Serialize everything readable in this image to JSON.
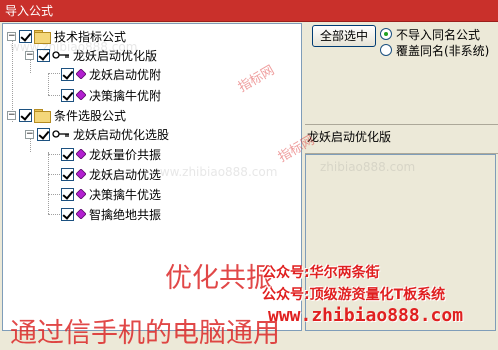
{
  "window": {
    "title": "导入公式"
  },
  "tree": {
    "groups": [
      {
        "label": "技术指标公式",
        "folders": [
          {
            "label": "龙妖启动优化版",
            "items": [
              "龙妖启动优附",
              "决策擒牛优附"
            ]
          }
        ]
      },
      {
        "label": "条件选股公式",
        "folders": [
          {
            "label": "龙妖启动优化选股",
            "items": [
              "龙妖量价共振",
              "龙妖启动优选",
              "决策擒牛优选",
              "智擒绝地共振"
            ]
          }
        ]
      }
    ]
  },
  "options": {
    "select_all_label": "全部选中",
    "radio_skip": "不导入同名公式",
    "radio_overwrite": "覆盖同名(非系统)"
  },
  "preview": {
    "label": "龙妖启动优化版"
  },
  "watermarks": {
    "big_1": "优化共振",
    "big_2": "通过信手机的电脑通用",
    "line_1": "公众号:华尔两条街",
    "line_2": "公众号:顶级游资量化T板系统",
    "site": "www.zhibiao888.com",
    "faint_1": "www.zhibiao888.com",
    "faint_2": "www.zhibiao888.com",
    "faint_3": "zhibiao888.com",
    "pink_1": "指标网",
    "pink_2": "指标网"
  }
}
